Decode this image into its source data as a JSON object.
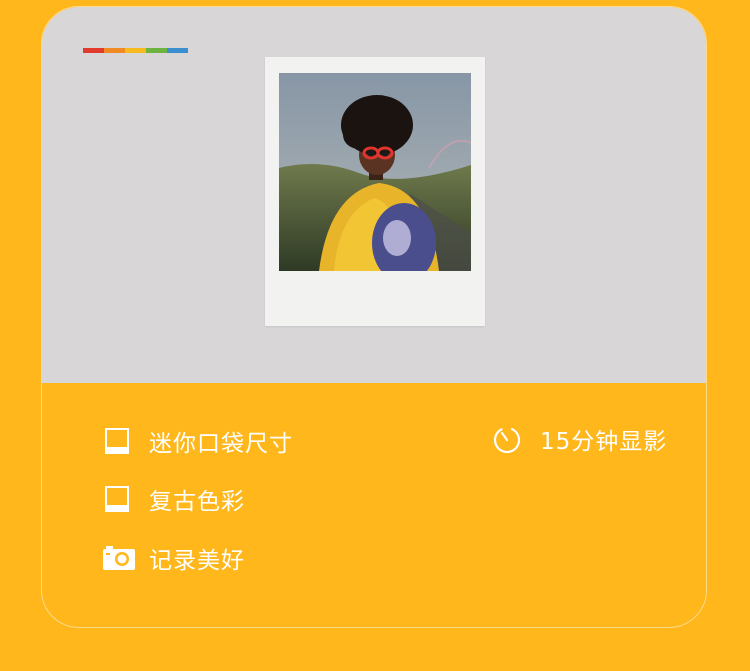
{
  "stripe_colors": [
    "#E23B2E",
    "#F08A24",
    "#F6B91E",
    "#6DB33F",
    "#3B8FD0"
  ],
  "colors": {
    "background": "#FFB71B",
    "top_panel": "#D8D6D7",
    "text": "#FFFFFF"
  },
  "features": {
    "size": {
      "label": "迷你口袋尺寸",
      "icon": "frame-icon"
    },
    "develop": {
      "label": "15分钟显影",
      "icon": "timer-icon"
    },
    "color": {
      "label": "复古色彩",
      "icon": "frame-icon"
    },
    "record": {
      "label": "记录美好",
      "icon": "camera-icon"
    }
  }
}
